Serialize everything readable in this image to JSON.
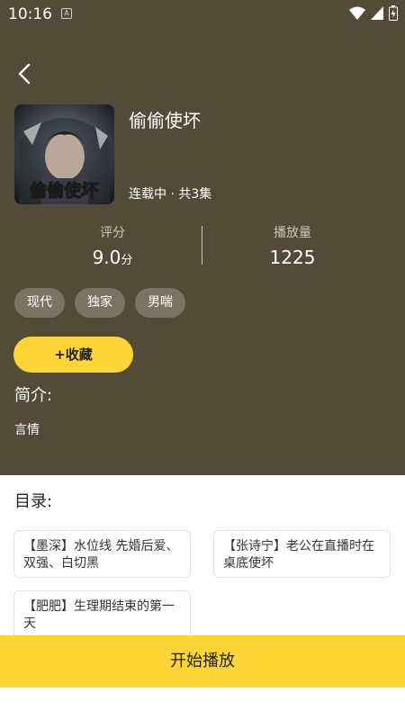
{
  "status_bar": {
    "time": "10:16",
    "notification_icon": "a-box-icon"
  },
  "nav": {
    "back_icon": "chevron-left-icon"
  },
  "drama": {
    "title": "偷偷使坏",
    "cover_text": "偷偷使坏",
    "status": "连载中 · 共3集"
  },
  "stats": {
    "rating_label": "评分",
    "rating_value": "9.0",
    "rating_unit": "分",
    "plays_label": "播放量",
    "plays_value": "1225"
  },
  "tags": [
    "现代",
    "独家",
    "男喘"
  ],
  "collect_button": "+收藏",
  "intro": {
    "heading": "简介:",
    "text": "言情"
  },
  "toc": {
    "heading": "目录:",
    "episodes": [
      "【墨深】水位线 先婚后爱、双强、白切黑",
      "【张诗宁】老公在直播时在桌底使坏",
      "【肥肥】生理期结束的第一天"
    ]
  },
  "play_button": "开始播放",
  "colors": {
    "header_bg": "#534a38",
    "accent": "#fdd535",
    "tag_bg": "#7b7463"
  }
}
